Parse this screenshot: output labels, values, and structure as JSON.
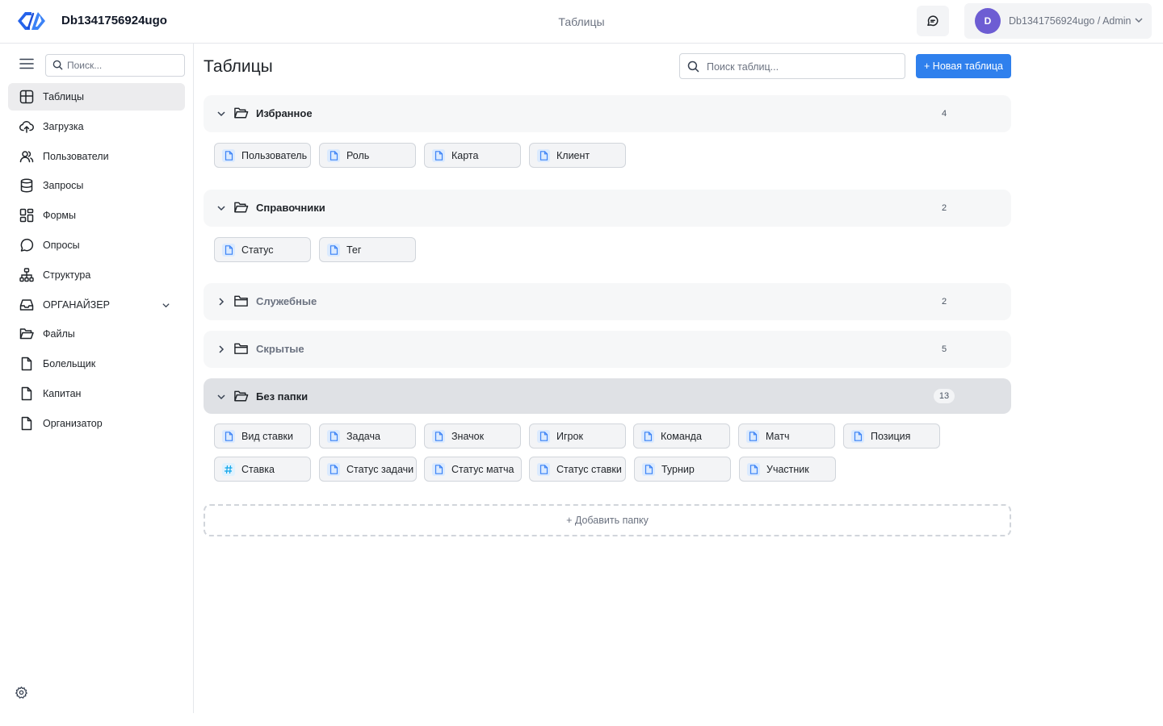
{
  "header": {
    "db_name": "Db1341756924ugo",
    "title": "Таблицы",
    "avatar_initial": "D",
    "user_label": "Db1341756924ugo / Admin"
  },
  "sidebar": {
    "search_placeholder": "Поиск...",
    "items": [
      {
        "label": "Таблицы",
        "icon": "table-icon",
        "active": true
      },
      {
        "label": "Загрузка",
        "icon": "upload-icon"
      },
      {
        "label": "Пользователи",
        "icon": "users-icon"
      },
      {
        "label": "Запросы",
        "icon": "database-icon"
      },
      {
        "label": "Формы",
        "icon": "grid-icon"
      },
      {
        "label": "Опросы",
        "icon": "chat-icon"
      },
      {
        "label": "Структура",
        "icon": "structure-icon"
      },
      {
        "label": "ОРГАНАЙЗЕР",
        "icon": "inbox-icon",
        "expandable": true
      },
      {
        "label": "Файлы",
        "icon": "folder-icon"
      },
      {
        "label": "Болельщик",
        "icon": "file-icon"
      },
      {
        "label": "Капитан",
        "icon": "file-icon"
      },
      {
        "label": "Организатор",
        "icon": "file-icon"
      }
    ]
  },
  "main": {
    "page_title": "Таблицы",
    "search_placeholder": "Поиск таблиц...",
    "new_table_label": "+ Новая таблица",
    "add_folder_label": "+ Добавить папку",
    "folders": [
      {
        "name": "Избранное",
        "count": "4",
        "expanded": true,
        "tables": [
          {
            "label": "Пользователь",
            "icon": "file-icon"
          },
          {
            "label": "Роль",
            "icon": "file-icon"
          },
          {
            "label": "Карта",
            "icon": "file-icon"
          },
          {
            "label": "Клиент",
            "icon": "file-icon"
          }
        ]
      },
      {
        "name": "Справочники",
        "count": "2",
        "expanded": true,
        "tables": [
          {
            "label": "Статус",
            "icon": "file-icon"
          },
          {
            "label": "Тег",
            "icon": "file-icon"
          }
        ]
      },
      {
        "name": "Служебные",
        "count": "2",
        "expanded": false,
        "tables": []
      },
      {
        "name": "Скрытые",
        "count": "5",
        "expanded": false,
        "tables": []
      },
      {
        "name": "Без папки",
        "count": "13",
        "expanded": true,
        "highlighted": true,
        "tables": [
          {
            "label": "Вид ставки",
            "icon": "file-icon"
          },
          {
            "label": "Задача",
            "icon": "file-icon"
          },
          {
            "label": "Значок",
            "icon": "file-icon"
          },
          {
            "label": "Игрок",
            "icon": "file-icon"
          },
          {
            "label": "Команда",
            "icon": "file-icon"
          },
          {
            "label": "Матч",
            "icon": "file-icon"
          },
          {
            "label": "Позиция",
            "icon": "file-icon"
          },
          {
            "label": "Ставка",
            "icon": "hash-icon"
          },
          {
            "label": "Статус задачи",
            "icon": "file-icon"
          },
          {
            "label": "Статус матча",
            "icon": "file-icon"
          },
          {
            "label": "Статус ставки",
            "icon": "file-icon"
          },
          {
            "label": "Турнир",
            "icon": "file-icon"
          },
          {
            "label": "Участник",
            "icon": "file-icon"
          }
        ]
      }
    ]
  }
}
